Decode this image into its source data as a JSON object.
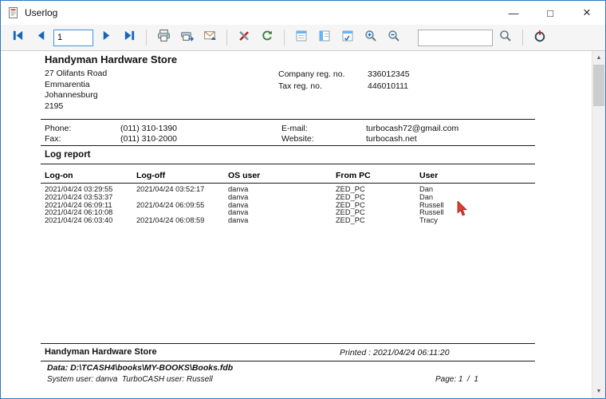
{
  "window": {
    "title": "Userlog",
    "controls": {
      "minimize": "—",
      "maximize": "□",
      "close": "×"
    }
  },
  "toolbar": {
    "page_value": "1",
    "search_value": "",
    "icons": [
      "nav-first",
      "nav-prev",
      "nav-next",
      "nav-last",
      "print",
      "print-setup",
      "email",
      "tools",
      "refresh",
      "outline-view",
      "thumbnail-view",
      "search-panel",
      "zoom-in",
      "zoom-out",
      "search",
      "exit-power"
    ],
    "accent_blue": "#1565c0",
    "refresh_green": "#2e7d32",
    "exit_red": "#c62828"
  },
  "scrollbar": {
    "up": "▲",
    "down": "▼"
  },
  "report": {
    "company_name": "Handyman Hardware Store",
    "address": [
      "27 Olifants Road",
      "Emmarentia",
      "Johannesburg",
      "2195"
    ],
    "registrations": {
      "company_label": "Company reg. no.",
      "company_value": "336012345",
      "tax_label": "Tax reg. no.",
      "tax_value": "446010111"
    },
    "contact": {
      "phone_label": "Phone:",
      "phone_value": "(011) 310-1390",
      "fax_label": "Fax:",
      "fax_value": "(011) 310-2000",
      "email_label": "E-mail:",
      "email_value": "turbocash72@gmail.com",
      "website_label": "Website:",
      "website_value": "turbocash.net"
    },
    "section_title": "Log report",
    "table": {
      "headers": [
        "Log-on",
        "Log-off",
        "OS user",
        "From PC",
        "User"
      ],
      "rows": [
        [
          "2021/04/24 03:29:55",
          "2021/04/24 03:52:17",
          "danva",
          "ZED_PC",
          "Dan"
        ],
        [
          "2021/04/24 03:53:37",
          "",
          "danva",
          "ZED_PC",
          "Dan"
        ],
        [
          "2021/04/24 06:09:11",
          "2021/04/24 06:09:55",
          "danva",
          "ZED_PC",
          "Russell"
        ],
        [
          "2021/04/24 06:10:08",
          "",
          "danva",
          "ZED_PC",
          "Russell"
        ],
        [
          "2021/04/24 06:03:40",
          "2021/04/24 06:08:59",
          "danva",
          "ZED_PC",
          "Tracy"
        ]
      ]
    },
    "footer": {
      "company": "Handyman Hardware Store",
      "printed": "Printed : 2021/04/24 06:11:20",
      "data_path": "Data: D:\\TCASH4\\books\\MY-BOOKS\\Books.fdb",
      "system_line": "System user: danva  TurboCASH user: Russell",
      "page_label": "Page: 1  /  1"
    }
  }
}
